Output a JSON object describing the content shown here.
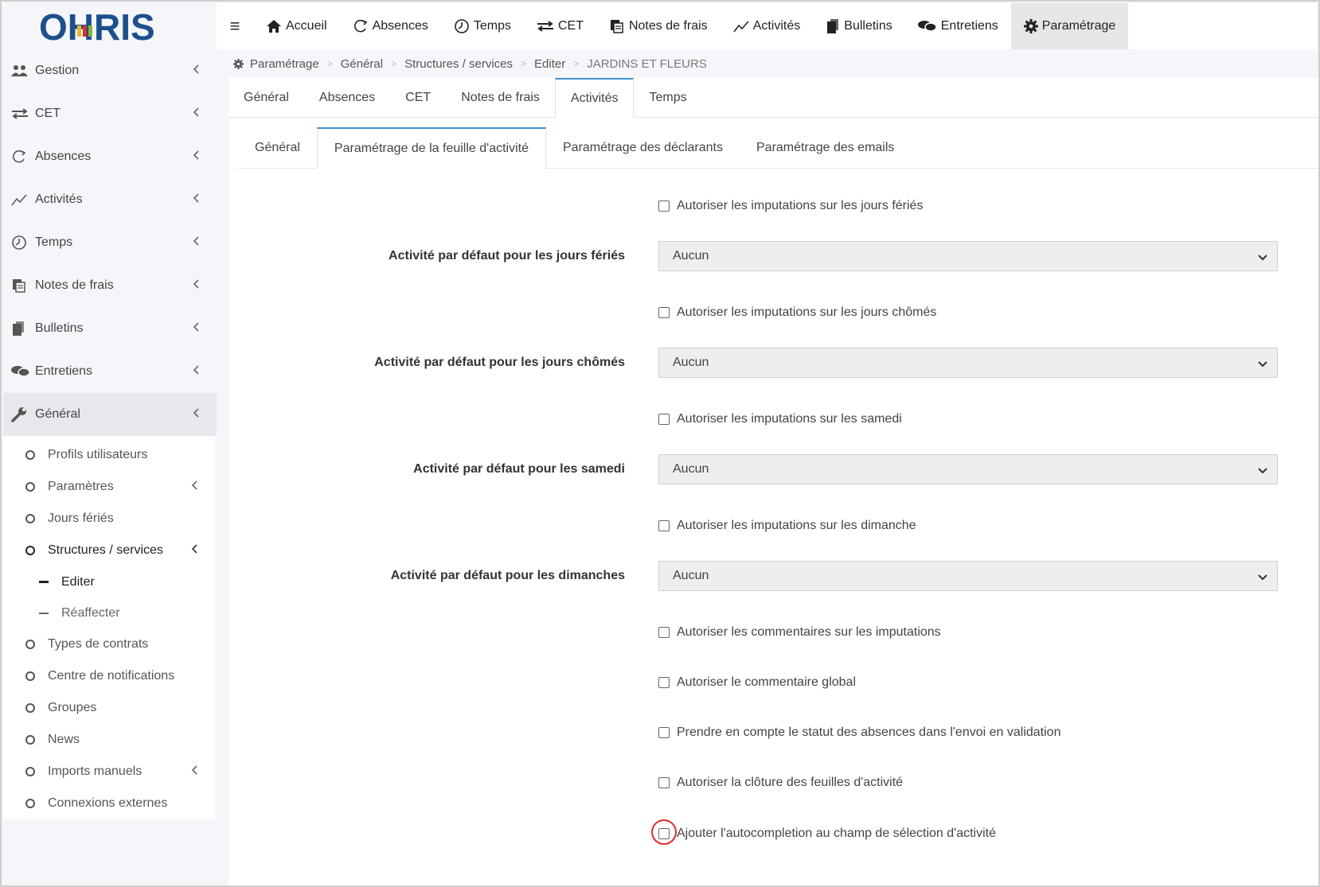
{
  "logo": {
    "text": "OHRIS"
  },
  "sidebar": {
    "items": [
      {
        "label": "Gestion",
        "icon": "users-icon"
      },
      {
        "label": "CET",
        "icon": "exchange-icon"
      },
      {
        "label": "Absences",
        "icon": "refresh-icon"
      },
      {
        "label": "Activités",
        "icon": "line-chart-icon"
      },
      {
        "label": "Temps",
        "icon": "clock-icon"
      },
      {
        "label": "Notes de frais",
        "icon": "receipt-icon"
      },
      {
        "label": "Bulletins",
        "icon": "document-icon"
      },
      {
        "label": "Entretiens",
        "icon": "comments-icon"
      },
      {
        "label": "Général",
        "icon": "wrench-icon"
      }
    ],
    "general_sub": [
      {
        "label": "Profils utilisateurs"
      },
      {
        "label": "Paramètres"
      },
      {
        "label": "Jours fériés"
      },
      {
        "label": "Structures / services"
      },
      {
        "label": "Types de contrats"
      },
      {
        "label": "Centre de notifications"
      },
      {
        "label": "Groupes"
      },
      {
        "label": "News"
      },
      {
        "label": "Imports manuels"
      },
      {
        "label": "Connexions externes"
      }
    ],
    "structures_sub": [
      {
        "label": "Editer"
      },
      {
        "label": "Réaffecter"
      }
    ]
  },
  "topnav": {
    "hamburger": "≡",
    "items": [
      {
        "label": "Accueil",
        "icon": "home-icon"
      },
      {
        "label": "Absences",
        "icon": "refresh-icon"
      },
      {
        "label": "Temps",
        "icon": "clock-icon"
      },
      {
        "label": "CET",
        "icon": "exchange-icon"
      },
      {
        "label": "Notes de frais",
        "icon": "receipt-icon"
      },
      {
        "label": "Activités",
        "icon": "line-chart-icon"
      },
      {
        "label": "Bulletins",
        "icon": "document-icon"
      },
      {
        "label": "Entretiens",
        "icon": "comments-icon"
      },
      {
        "label": "Paramétrage",
        "icon": "gear-icon"
      }
    ]
  },
  "breadcrumb": {
    "items": [
      "Paramétrage",
      "Général",
      "Structures / services",
      "Editer",
      "JARDINS ET FLEURS"
    ],
    "separator": ">"
  },
  "tabs1": [
    "Général",
    "Absences",
    "CET",
    "Notes de frais",
    "Activités",
    "Temps"
  ],
  "tabs2": [
    "Général",
    "Paramétrage de la feuille d'activité",
    "Paramétrage des déclarants",
    "Paramétrage des emails"
  ],
  "form": {
    "check_feries": "Autoriser les imputations sur les jours fériés",
    "label_feries": "Activité par défaut pour les jours fériés",
    "select_feries": "Aucun",
    "check_chomes": "Autoriser les imputations sur les jours chômés",
    "label_chomes": "Activité par défaut pour les jours chômés",
    "select_chomes": "Aucun",
    "check_samedi": "Autoriser les imputations sur les samedi",
    "label_samedi": "Activité par défaut pour les samedi",
    "select_samedi": "Aucun",
    "check_dimanche": "Autoriser les imputations sur les dimanche",
    "label_dimanche": "Activité par défaut pour les dimanches",
    "select_dimanche": "Aucun",
    "check_commentaires": "Autoriser les commentaires sur les imputations",
    "check_global": "Autoriser le commentaire global",
    "check_statut": "Prendre en compte le statut des absences dans l'envoi en validation",
    "check_cloture": "Autoriser la clôture des feuilles d'activité",
    "check_autocompletion": "Ajouter l'autocompletion au champ de sélection d'activité"
  },
  "colors": {
    "accent_tab": "#3d8fd1",
    "highlight_ring": "#d9302c",
    "logo_blue": "#1d4f8c"
  }
}
